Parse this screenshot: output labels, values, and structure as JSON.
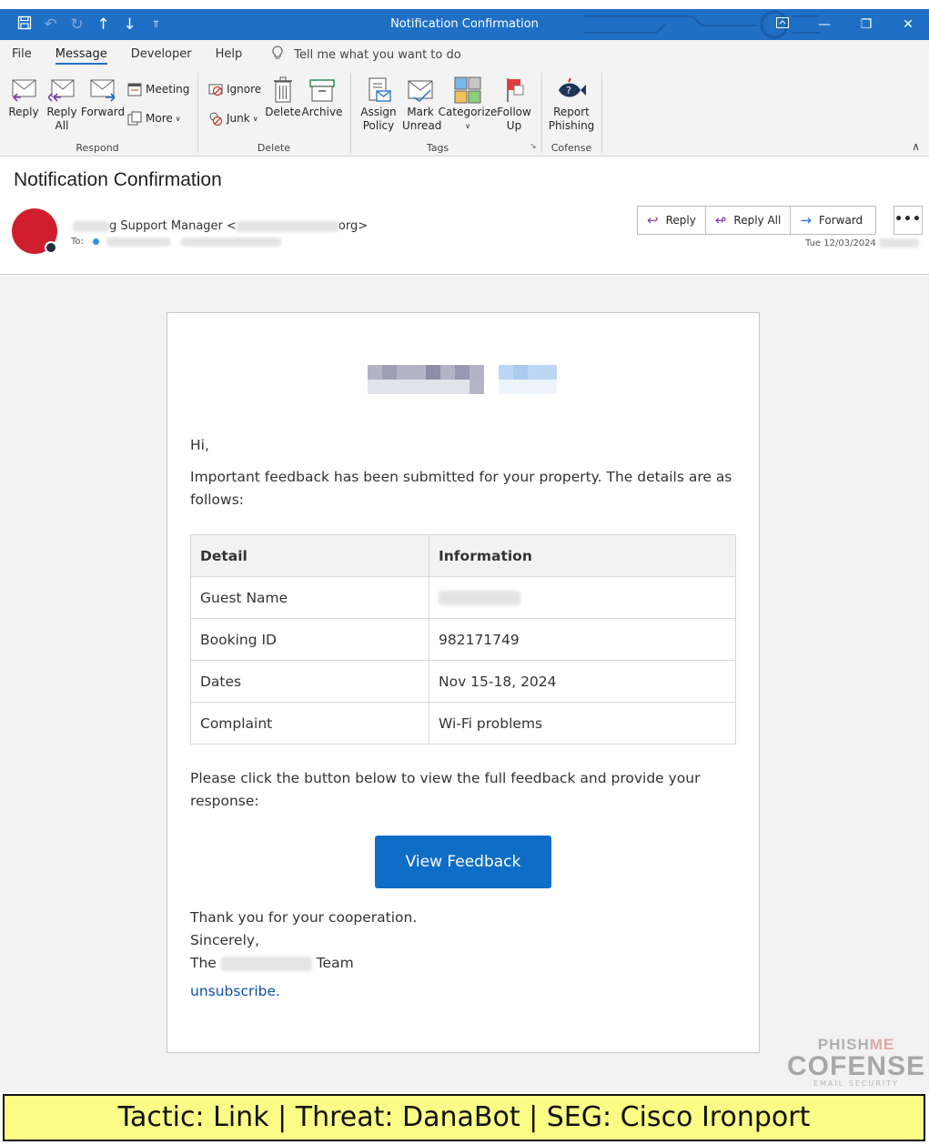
{
  "window": {
    "title": "Notification Confirmation",
    "accent": "#1f6fc5"
  },
  "menu": {
    "tabs": [
      "File",
      "Message",
      "Developer",
      "Help"
    ],
    "active_tab": "Message",
    "tell_me": "Tell me what you want to do"
  },
  "ribbon": {
    "respond": {
      "reply": "Reply",
      "reply_all": "Reply All",
      "forward": "Forward",
      "meeting": "Meeting",
      "more": "More",
      "group": "Respond"
    },
    "delete": {
      "ignore": "Ignore",
      "junk": "Junk",
      "delete": "Delete",
      "archive": "Archive",
      "group": "Delete"
    },
    "tags": {
      "assign_policy": "Assign Policy",
      "mark_unread": "Mark Unread",
      "categorize": "Categorize",
      "follow_up": "Follow Up",
      "group": "Tags"
    },
    "cofense": {
      "report_phishing": "Report Phishing",
      "group": "Cofense"
    }
  },
  "message": {
    "subject": "Notification Confirmation",
    "sender_visible": "g Support Manager <",
    "sender_domain_visible": "org>",
    "to_label": "To:",
    "date": "Tue 12/03/2024",
    "actions": {
      "reply": "Reply",
      "reply_all": "Reply All",
      "forward": "Forward",
      "more": "•••"
    }
  },
  "email": {
    "greeting": "Hi,",
    "intro": "Important feedback has been submitted for your property. The details are as follows:",
    "table": {
      "headers": [
        "Detail",
        "Information"
      ],
      "rows": [
        [
          "Guest Name",
          ""
        ],
        [
          "Booking ID",
          "982171749"
        ],
        [
          "Dates",
          "Nov 15-18, 2024"
        ],
        [
          "Complaint",
          "Wi-Fi problems"
        ]
      ]
    },
    "cta_text": "Please click the button below to view the full feedback and provide your response:",
    "button": "View Feedback",
    "button_color": "#0d6dc7",
    "thanks": "Thank you for your cooperation.",
    "sincerely": "Sincerely,",
    "signoff_prefix": "The",
    "signoff_suffix": "Team",
    "unsubscribe": "unsubscribe."
  },
  "watermark": {
    "phishme": "PhishMe",
    "cofense": "COFENSE",
    "tagline": "EMAIL SECURITY"
  },
  "banner": {
    "text": "Tactic: Link | Threat: DanaBot | SEG: Cisco Ironport",
    "background": "#fbfc86"
  }
}
